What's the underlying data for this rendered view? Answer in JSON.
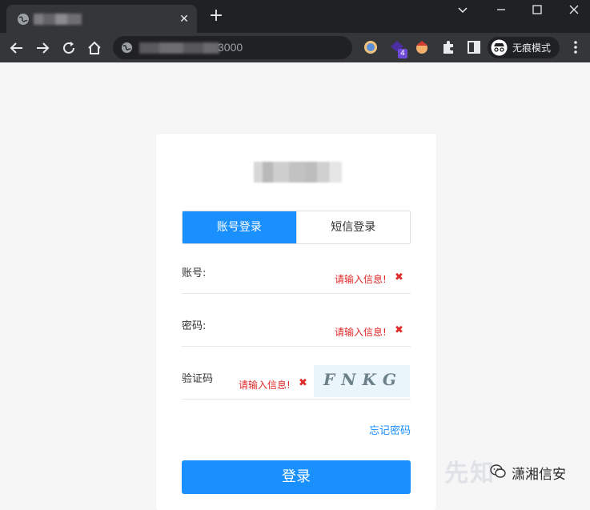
{
  "browser": {
    "tab_close_glyph": "✕",
    "new_tab_glyph": "+",
    "address_suffix": "3000",
    "extension_badge": "4",
    "incognito_label": "无痕模式",
    "window_controls": {
      "dropdown": "⌄",
      "minimize": "—",
      "maximize": "☐",
      "close": "✕"
    }
  },
  "login": {
    "tabs": [
      {
        "label": "账号登录",
        "active": true
      },
      {
        "label": "短信登录",
        "active": false
      }
    ],
    "fields": [
      {
        "label": "账号:",
        "error": "请输入信息!",
        "error_icon": "✖"
      },
      {
        "label": "密码:",
        "error": "请输入信息!",
        "error_icon": "✖"
      },
      {
        "label": "验证码",
        "error": "请输入信息!",
        "error_icon": "✖"
      }
    ],
    "captcha_text": "FNKG",
    "forgot_password": "忘记密码",
    "submit_label": "登录"
  },
  "overlay": {
    "watermark_text": "先知",
    "wechat_account": "潇湘信安"
  },
  "colors": {
    "accent": "#1a90ff",
    "error": "#e02a2a",
    "page_bg": "#f6f6f7",
    "chrome_dark": "#202124",
    "chrome_toolbar": "#35363a"
  }
}
